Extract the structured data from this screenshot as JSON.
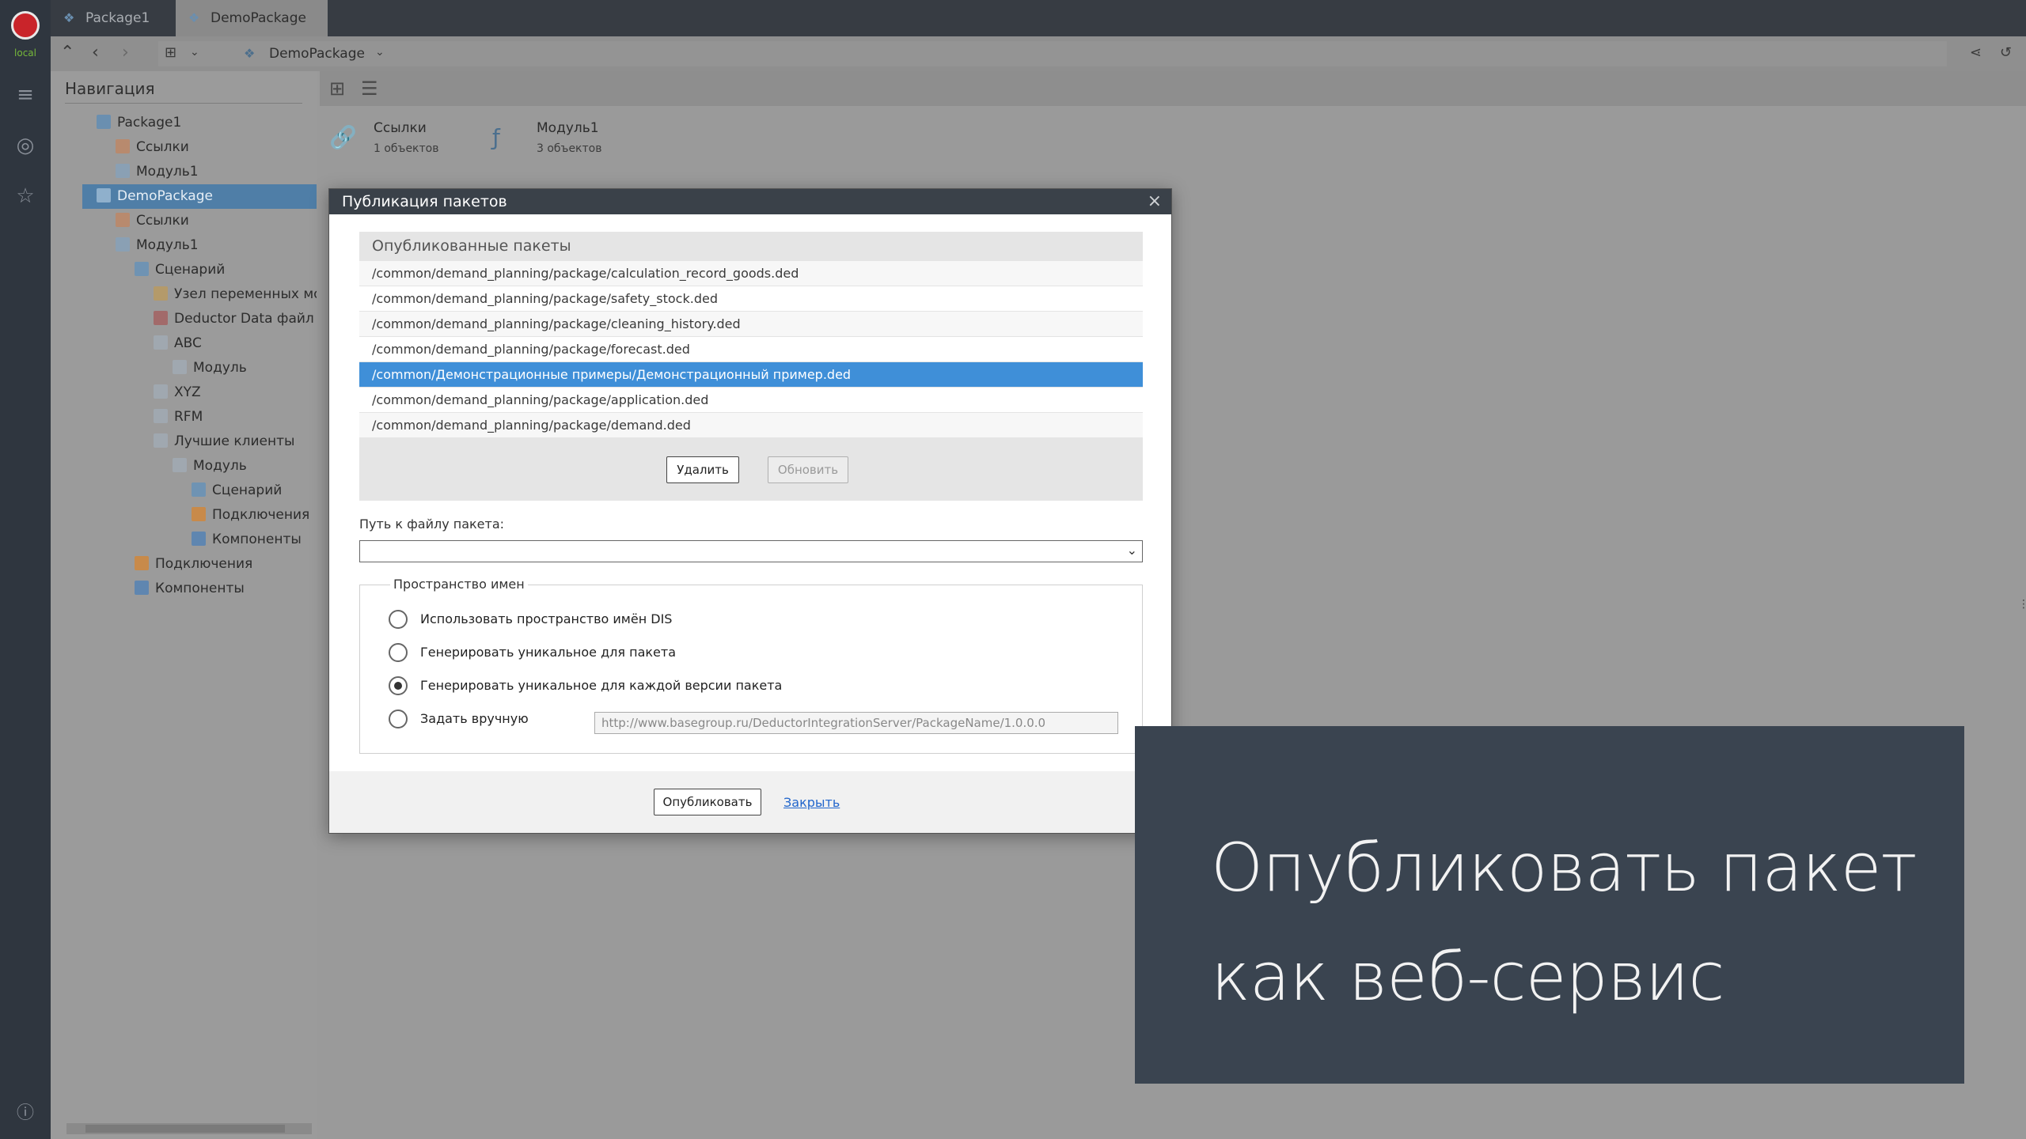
{
  "app": {
    "logo_sub": "local"
  },
  "tabs": [
    {
      "label": "Package1",
      "active": false
    },
    {
      "label": "DemoPackage",
      "active": true
    }
  ],
  "address": {
    "crumb": "DemoPackage"
  },
  "navigation": {
    "title": "Навигация",
    "items": [
      {
        "label": "Package1"
      },
      {
        "label": "Ссылки"
      },
      {
        "label": "Модуль1"
      },
      {
        "label": "DemoPackage"
      },
      {
        "label": "Ссылки"
      },
      {
        "label": "Модуль1"
      },
      {
        "label": "Сценарий"
      },
      {
        "label": "Узел переменных мод"
      },
      {
        "label": "Deductor Data файл"
      },
      {
        "label": "ABC"
      },
      {
        "label": "Модуль"
      },
      {
        "label": "XYZ"
      },
      {
        "label": "RFM"
      },
      {
        "label": "Лучшие клиенты"
      },
      {
        "label": "Модуль"
      },
      {
        "label": "Сценарий"
      },
      {
        "label": "Подключения"
      },
      {
        "label": "Компоненты"
      },
      {
        "label": "Подключения"
      },
      {
        "label": "Компоненты"
      }
    ]
  },
  "workspace": {
    "cards": [
      {
        "name": "Ссылки",
        "count": "1 объектов"
      },
      {
        "name": "Модуль1",
        "count": "3 объектов"
      }
    ]
  },
  "dialog": {
    "title": "Публикация пакетов",
    "published_title": "Опубликованные пакеты",
    "packages": [
      "/common/demand_planning/package/calculation_record_goods.ded",
      "/common/demand_planning/package/safety_stock.ded",
      "/common/demand_planning/package/cleaning_history.ded",
      "/common/demand_planning/package/forecast.ded",
      "/common/Демонстрационные примеры/Демонстрационный пример.ded",
      "/common/demand_planning/package/application.ded",
      "/common/demand_planning/package/demand.ded"
    ],
    "selected_index": 4,
    "delete_label": "Удалить",
    "refresh_label": "Обновить",
    "path_label": "Путь к файлу пакета:",
    "path_value": "",
    "namespace_legend": "Пространство имен",
    "options": [
      "Использовать пространство имён DIS",
      "Генерировать уникальное для пакета",
      "Генерировать уникальное для каждой версии пакета",
      "Задать вручную"
    ],
    "selected_option": 2,
    "manual_placeholder": "http://www.basegroup.ru/DeductorIntegrationServer/PackageName/1.0.0.0",
    "publish_label": "Опубликовать",
    "close_label": "Закрыть"
  },
  "caption": {
    "line1": "Опубликовать пакет",
    "line2": "как веб-сервис"
  }
}
